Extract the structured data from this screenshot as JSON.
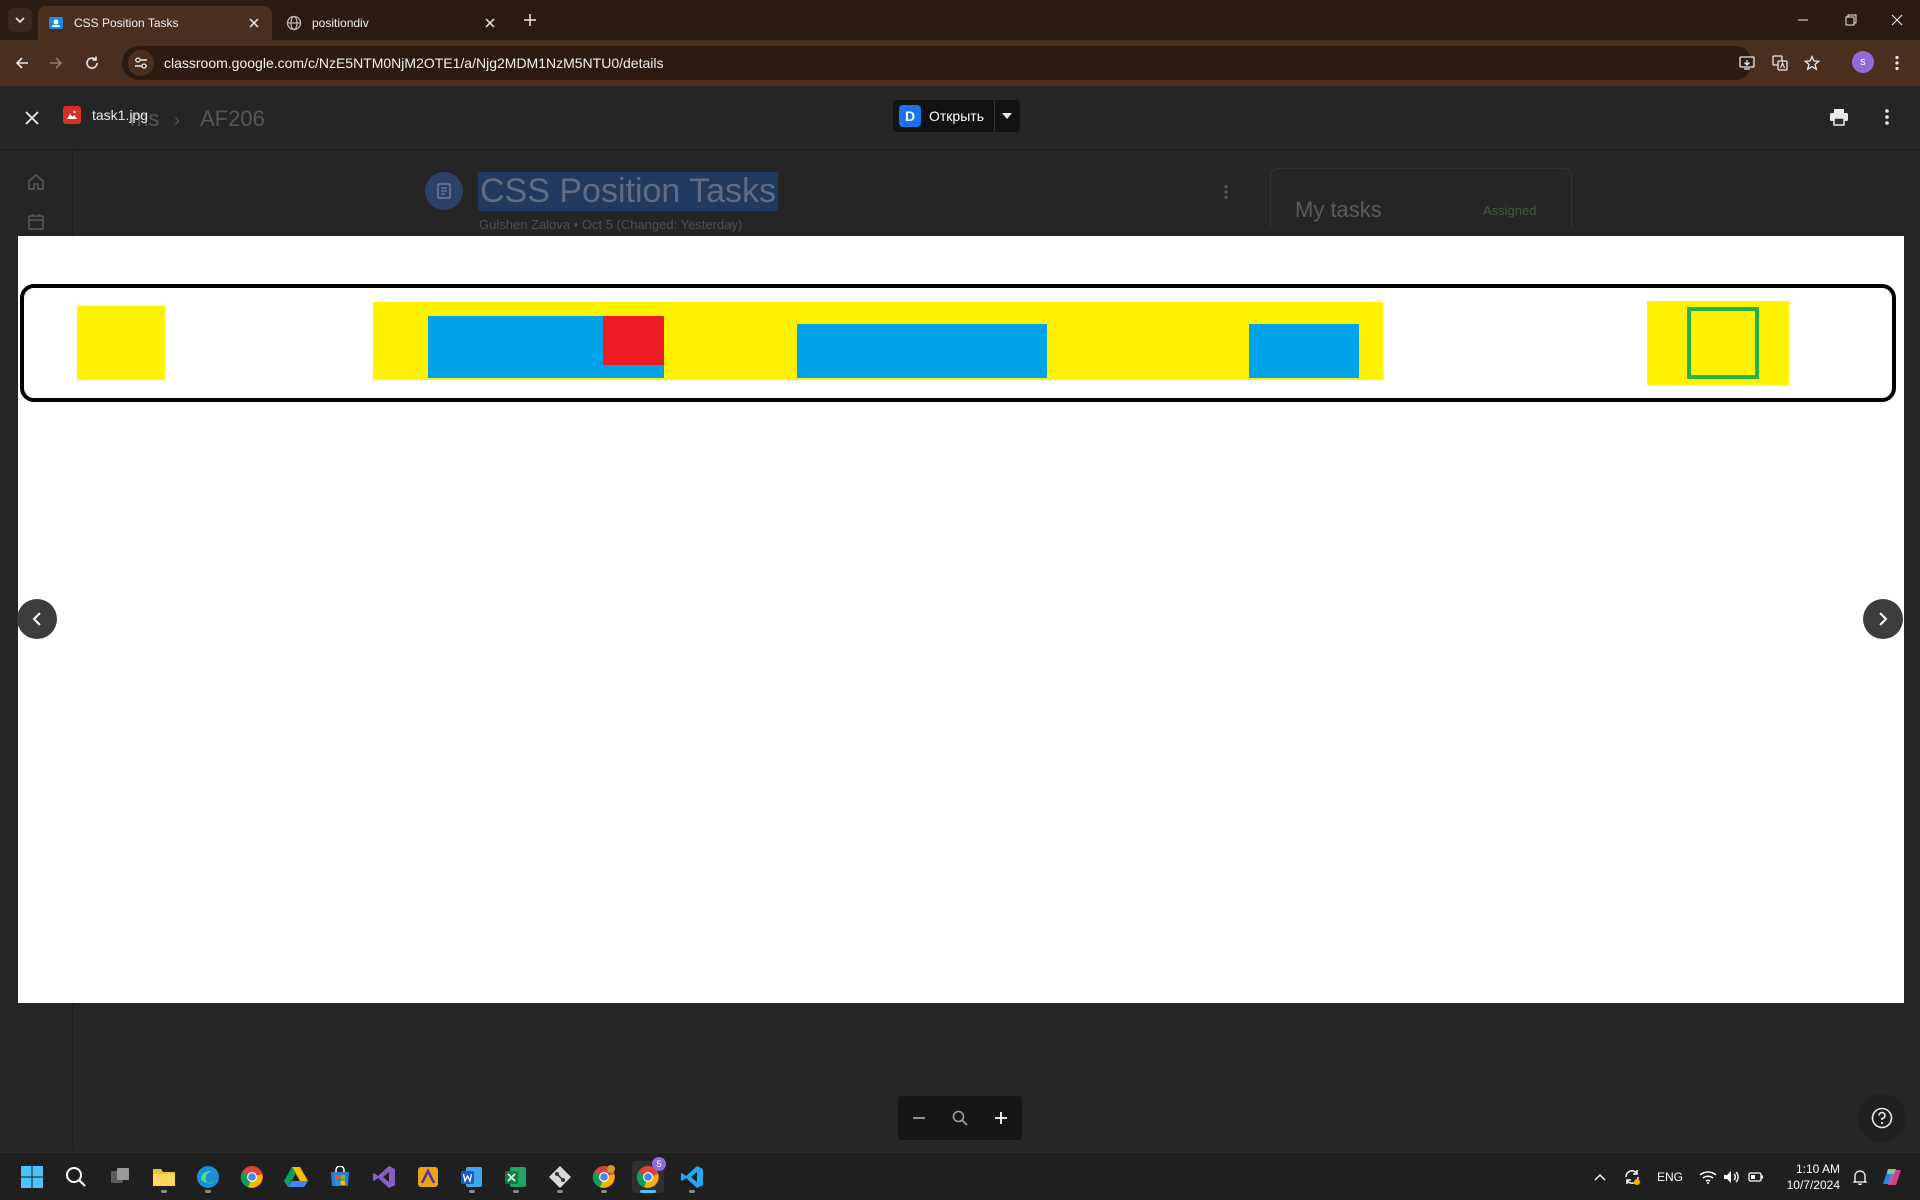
{
  "browser": {
    "tabs": [
      {
        "title": "CSS Position Tasks",
        "active": true
      },
      {
        "title": "positiondiv",
        "active": false
      }
    ],
    "url": "classroom.google.com/c/NzE5NTM0NjM2OTE1/a/Njg2MDM1NzM5NTU0/details",
    "profile_initial": "s"
  },
  "classroom": {
    "breadcrumb_left": "ms",
    "breadcrumb_class": "AF206",
    "assignment_title": "CSS Position Tasks",
    "assignment_meta": "Gulshen Zalova • Oct 5 (Changed: Yesterday)",
    "tasks_card_title": "My tasks",
    "tasks_card_status": "Assigned"
  },
  "viewer": {
    "filename": "task1.jpg",
    "open_label": "Открыть",
    "image_bg": "#ffffff",
    "colors": {
      "yellow": "#fff200",
      "blue": "#00a2e8",
      "red": "#ed1c24",
      "green": "#22b14c"
    }
  },
  "taskbar": {
    "apps": [
      "windows-start",
      "search",
      "task-view",
      "file-explorer",
      "edge",
      "chrome",
      "google-drive",
      "microsoft-store",
      "visual-studio",
      "app-7",
      "word",
      "excel",
      "git",
      "chrome-profile-2",
      "chrome-profile-3",
      "vscode"
    ],
    "active_app": "chrome-profile-3",
    "badge": "5",
    "language": "ENG",
    "time": "1:10 AM",
    "date": "10/7/2024"
  }
}
